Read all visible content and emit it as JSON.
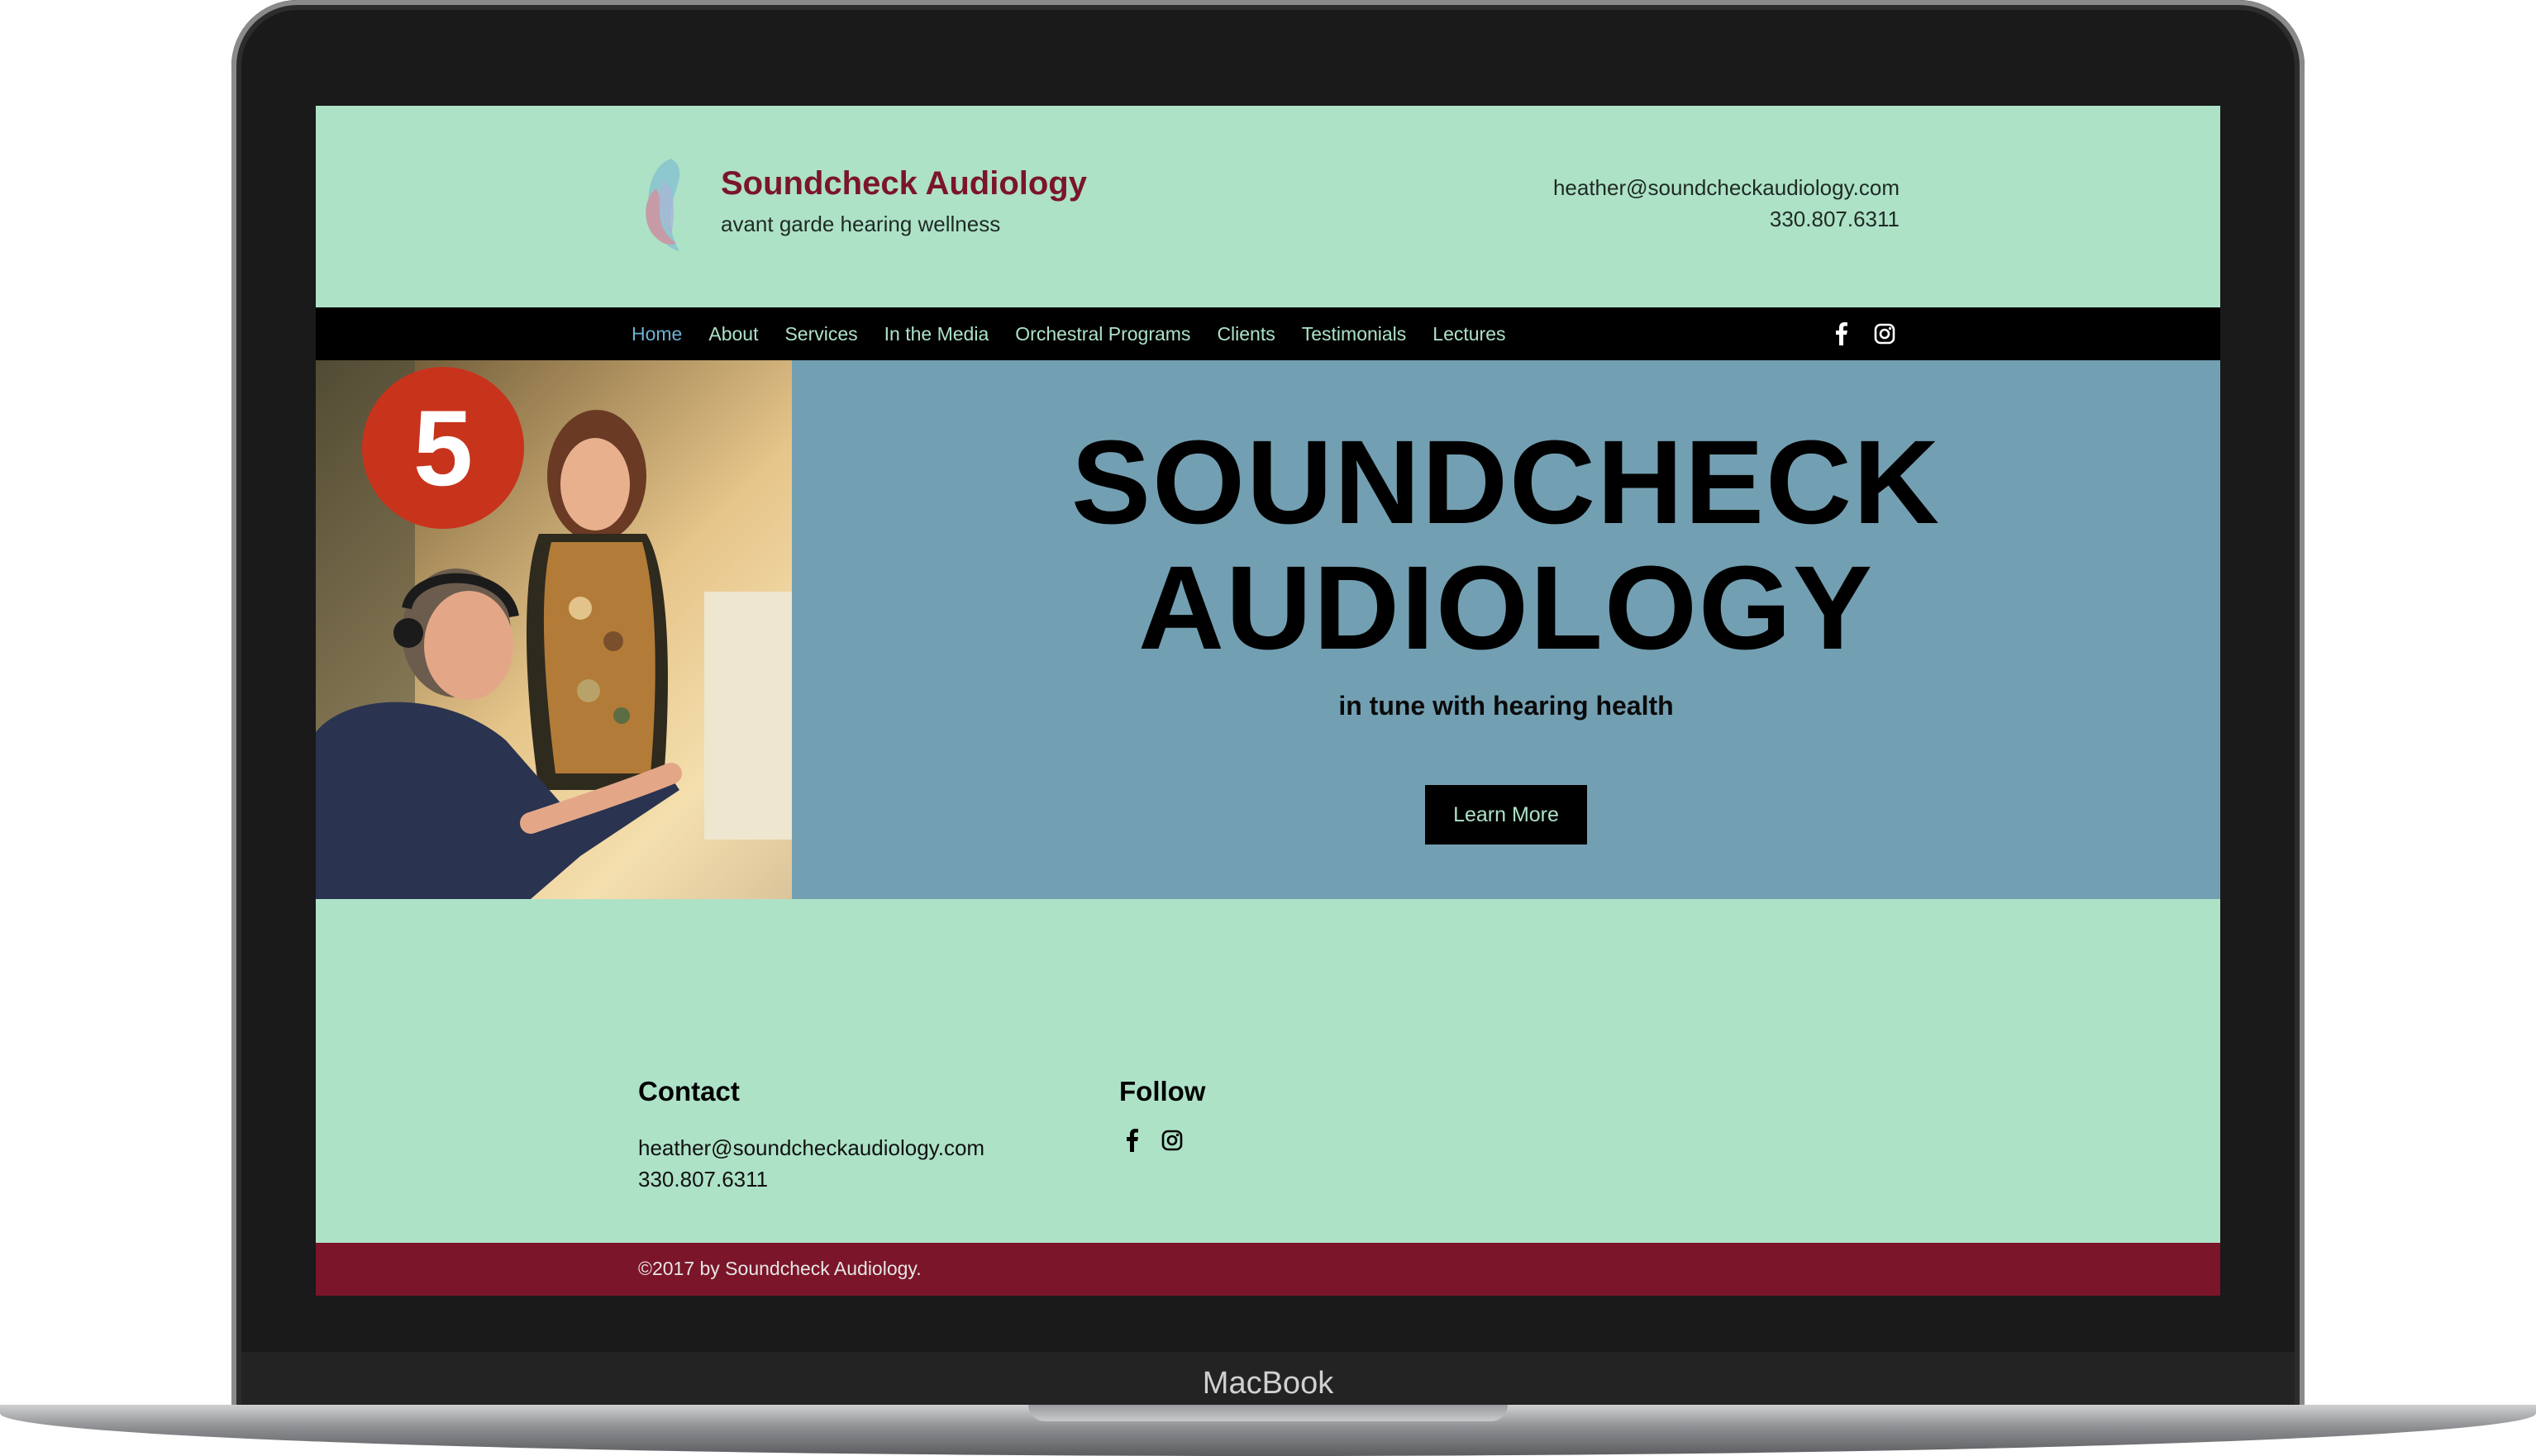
{
  "device": {
    "label": "MacBook"
  },
  "header": {
    "brand_name": "Soundcheck Audiology",
    "tagline": "avant garde hearing wellness",
    "email": "heather@soundcheckaudiology.com",
    "phone": "330.807.6311"
  },
  "nav": {
    "items": [
      {
        "label": "Home",
        "active": true
      },
      {
        "label": "About"
      },
      {
        "label": "Services"
      },
      {
        "label": "In the Media"
      },
      {
        "label": "Orchestral Programs"
      },
      {
        "label": "Clients"
      },
      {
        "label": "Testimonials"
      },
      {
        "label": "Lectures"
      }
    ],
    "social": [
      "facebook-icon",
      "instagram-icon"
    ]
  },
  "hero": {
    "title_line1": "SOUNDCHECK",
    "title_line2": "AUDIOLOGY",
    "subtitle": "in tune with hearing health",
    "button_label": "Learn More",
    "badge_number": "5"
  },
  "footer": {
    "contact_heading": "Contact",
    "follow_heading": "Follow",
    "email": "heather@soundcheckaudiology.com",
    "phone": "330.807.6311",
    "copyright": "©2017 by Soundcheck Audiology."
  },
  "colors": {
    "mint": "#ade2c7",
    "burgundy": "#7b1529",
    "hero_blue": "#739fb2",
    "nav_active": "#6fb0d2",
    "badge_red": "#c8331c"
  }
}
